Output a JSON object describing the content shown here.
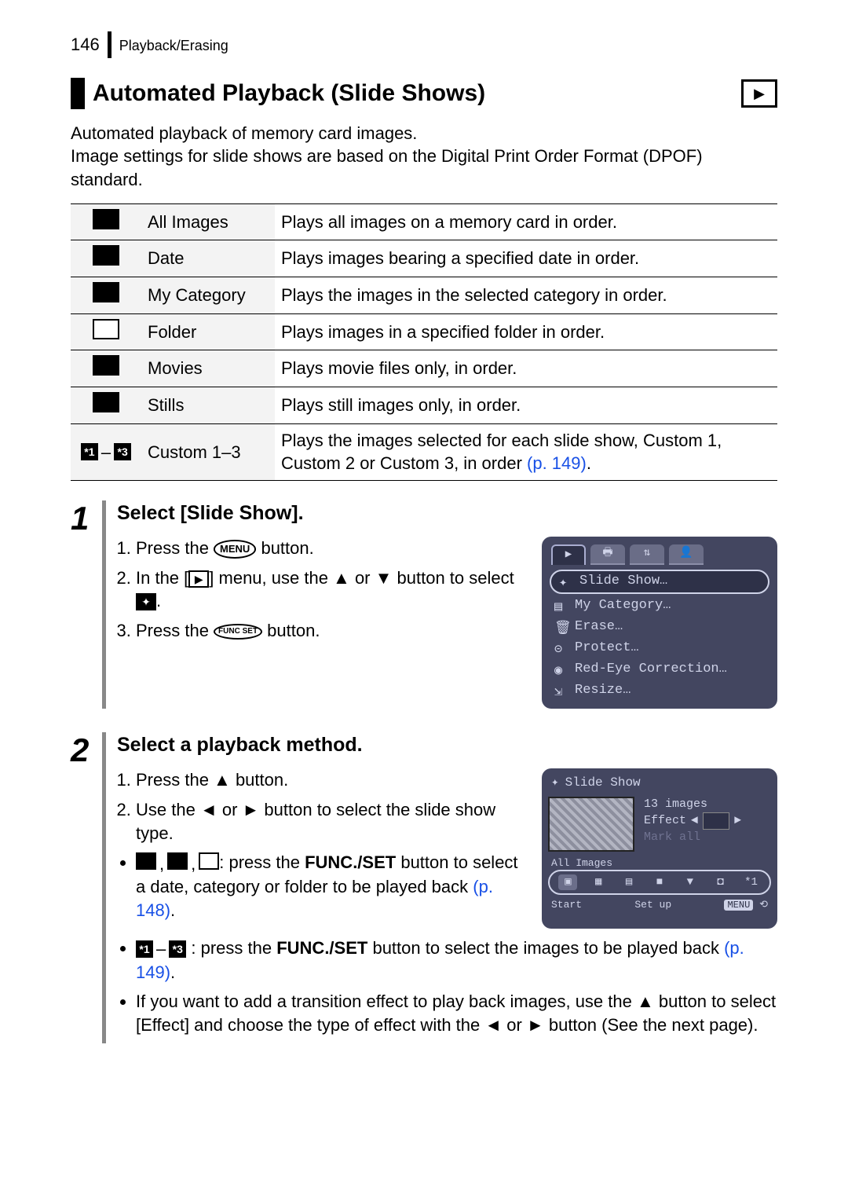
{
  "header": {
    "page_number": "146",
    "breadcrumb": "Playback/Erasing"
  },
  "title": "Automated Playback (Slide Shows)",
  "intro_lines": [
    "Automated playback of memory card images.",
    "Image settings for slide shows are based on the Digital Print Order Format (DPOF) standard."
  ],
  "options_table": [
    {
      "name": "All Images",
      "desc": "Plays all images on a memory card in order."
    },
    {
      "name": "Date",
      "desc": "Plays images bearing a specified date in order."
    },
    {
      "name": "My Category",
      "desc": "Plays the images in the selected category in order."
    },
    {
      "name": "Folder",
      "desc": "Plays images in a specified folder in order."
    },
    {
      "name": "Movies",
      "desc": "Plays movie files only, in order."
    },
    {
      "name": "Stills",
      "desc": "Plays still images only, in order."
    },
    {
      "name": "Custom 1–3",
      "desc_prefix": "Plays the images selected for each slide show, Custom 1, Custom 2 or Custom 3, in order ",
      "desc_link": "(p. 149)",
      "desc_suffix": "."
    }
  ],
  "step1": {
    "num": "1",
    "title": "Select [Slide Show].",
    "li1_a": "Press the ",
    "li1_btn": "MENU",
    "li1_b": " button.",
    "li2_a": "In the [",
    "li2_b": "] menu, use the ",
    "li2_c": " or ",
    "li2_d": " button to select ",
    "li2_e": ".",
    "li3_a": "Press the ",
    "li3_btn": "FUNC SET",
    "li3_b": " button.",
    "screenshot_menu": {
      "selected": "Slide Show…",
      "items": [
        "My Category…",
        "Erase…",
        "Protect…",
        "Red-Eye Correction…",
        "Resize…"
      ]
    }
  },
  "step2": {
    "num": "2",
    "title": "Select a playback method.",
    "li1_a": "Press the ",
    "li1_b": " button.",
    "li2_a": "Use the ",
    "li2_b": " or ",
    "li2_c": " button to select the slide show type.",
    "b1_a": ", ",
    "b1_pressfs": ": press the ",
    "b1_fs": "FUNC./SET",
    "b1_rest": " button to select a date, category or folder to be played back ",
    "b1_link": "(p. 148)",
    "b1_end": ".",
    "b2_a": ": press the ",
    "b2_fs": "FUNC./SET",
    "b2_rest": " button to select the images to be played back ",
    "b2_link": "(p. 149)",
    "b2_end": ".",
    "b3": "If you want to add a transition effect to play back images, use the ",
    "b3_b": " button to select [Effect] and choose the type of effect with the ",
    "b3_c": " or ",
    "b3_d": " button (See the next page).",
    "screenshot2": {
      "title": "Slide Show",
      "count": "13 images",
      "effect_label": "Effect",
      "mark_all": "Mark all",
      "all_images": "All Images",
      "start": "Start",
      "setup": "Set up",
      "menu": "MENU"
    }
  },
  "arrows": {
    "up": "▲",
    "down": "▼",
    "left": "◄",
    "right": "►",
    "play": "▶"
  },
  "custom_icon_labels": {
    "c1": "*1",
    "dash": "–",
    "c3": "*3"
  }
}
